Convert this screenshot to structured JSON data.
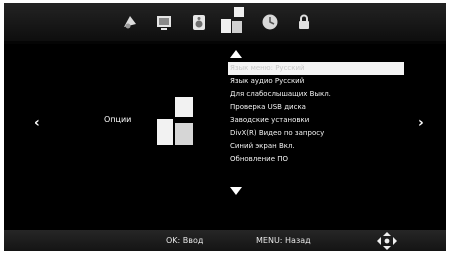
{
  "tabs": [
    {
      "icon": "satellite-dish-icon"
    },
    {
      "icon": "picture-icon"
    },
    {
      "icon": "sound-icon"
    },
    {
      "icon": "options-blocks-icon",
      "active": true
    },
    {
      "icon": "clock-icon"
    },
    {
      "icon": "lock-icon"
    }
  ],
  "nav": {
    "left_arrow": "‹",
    "right_arrow": "›"
  },
  "category": {
    "label": "Опции",
    "icon": "options-blocks-icon"
  },
  "menu": {
    "items": [
      "Язык меню: Русский",
      "Язык аудио Русский",
      "Для слабослышащих Выкл.",
      "Проверка USB диска",
      "Заводские установки",
      "DivX(R) Видео по запросу",
      "Синий экран Вкл.",
      "Обновление ПО"
    ],
    "selected_index": 0
  },
  "footer": {
    "ok_hint": "OK: Ввод",
    "menu_hint": "MENU: Назад",
    "nav_icon": "dpad-arrows-icon"
  },
  "colors": {
    "background": "#050505",
    "text": "#f2f2f2",
    "highlight": "#f4f4f4"
  }
}
